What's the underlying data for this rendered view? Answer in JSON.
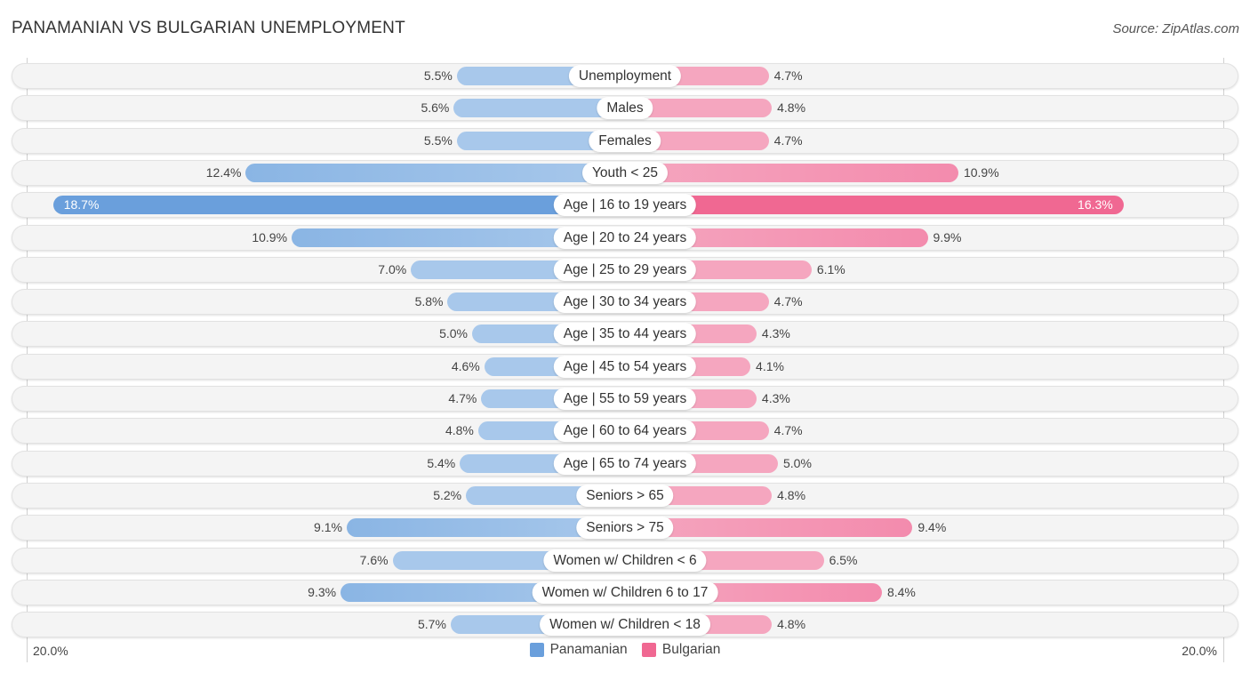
{
  "header": {
    "title": "PANAMANIAN VS BULGARIAN UNEMPLOYMENT",
    "source": "Source: ZipAtlas.com"
  },
  "colors": {
    "panamanian": "#6a9fdc",
    "panamanian_light": "#a8c8eb",
    "bulgarian": "#f06892",
    "bulgarian_light": "#f5a6bf"
  },
  "chart_data": {
    "type": "bar",
    "orientation": "horizontal-diverging",
    "title": "PANAMANIAN VS BULGARIAN UNEMPLOYMENT",
    "xlim": [
      -20,
      20
    ],
    "axis_labels": {
      "left": "20.0%",
      "right": "20.0%"
    },
    "legend": {
      "position": "bottom-center",
      "entries": [
        "Panamanian",
        "Bulgarian"
      ]
    },
    "categories": [
      "Unemployment",
      "Males",
      "Females",
      "Youth < 25",
      "Age | 16 to 19 years",
      "Age | 20 to 24 years",
      "Age | 25 to 29 years",
      "Age | 30 to 34 years",
      "Age | 35 to 44 years",
      "Age | 45 to 54 years",
      "Age | 55 to 59 years",
      "Age | 60 to 64 years",
      "Age | 65 to 74 years",
      "Seniors > 65",
      "Seniors > 75",
      "Women w/ Children < 6",
      "Women w/ Children 6 to 17",
      "Women w/ Children < 18"
    ],
    "series": [
      {
        "name": "Panamanian",
        "values": [
          5.5,
          5.6,
          5.5,
          12.4,
          18.7,
          10.9,
          7.0,
          5.8,
          5.0,
          4.6,
          4.7,
          4.8,
          5.4,
          5.2,
          9.1,
          7.6,
          9.3,
          5.7
        ]
      },
      {
        "name": "Bulgarian",
        "values": [
          4.7,
          4.8,
          4.7,
          10.9,
          16.3,
          9.9,
          6.1,
          4.7,
          4.3,
          4.1,
          4.3,
          4.7,
          5.0,
          4.8,
          9.4,
          6.5,
          8.4,
          4.8
        ]
      }
    ],
    "value_labels": {
      "Panamanian": [
        "5.5%",
        "5.6%",
        "5.5%",
        "12.4%",
        "18.7%",
        "10.9%",
        "7.0%",
        "5.8%",
        "5.0%",
        "4.6%",
        "4.7%",
        "4.8%",
        "5.4%",
        "5.2%",
        "9.1%",
        "7.6%",
        "9.3%",
        "5.7%"
      ],
      "Bulgarian": [
        "4.7%",
        "4.8%",
        "4.7%",
        "10.9%",
        "16.3%",
        "9.9%",
        "6.1%",
        "4.7%",
        "4.3%",
        "4.1%",
        "4.3%",
        "4.7%",
        "5.0%",
        "4.8%",
        "9.4%",
        "6.5%",
        "8.4%",
        "4.8%"
      ]
    }
  }
}
